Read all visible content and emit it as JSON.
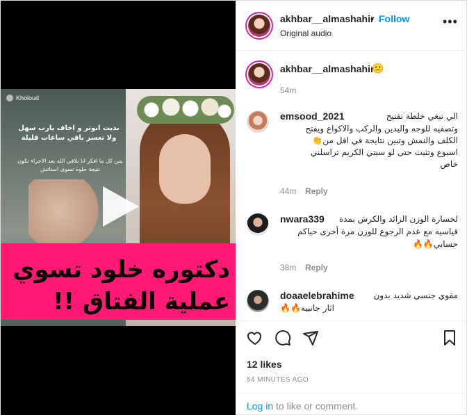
{
  "post": {
    "username": "akhbar__almashahir",
    "follow_label": "Follow",
    "separator": "•",
    "audio": "Original audio",
    "caption_emoji": "😕",
    "caption_time": "54m"
  },
  "media": {
    "story_name": "Kholoud",
    "story_text_main": "بديت انوتر و اخاف يارب سهل ولا تعسر باقي ساعات قليلة",
    "story_text_small": "بس كل ما افكر انا بلاقي الله بعد الاجراء تكون نتيجة حلوة تسوى استاتش",
    "banner_line1": "دكتوره خلود تسوي",
    "banner_line2": "عملية الفتاق !!"
  },
  "comments": [
    {
      "username": "emsood_2021",
      "text_line1": "الي تبغي خلطة تفتيح",
      "text_lines": [
        "وتصفيه للوجه واليدين والركب والاكواع ويفتح",
        "الكلف والنمش وتبين نتايجة في اقل من👏",
        "اسبوع وتثبت حتى لو سبتي الكريم تراسلني",
        "خاص"
      ],
      "time": "44m",
      "reply": "Reply"
    },
    {
      "username": "nwara339",
      "text_line1": "لخسارة الوزن الزائد والكرش بمدة",
      "text_lines": [
        "قياسيه مع عدم الرجوع للوزن مرة أخرى حياكم",
        "حسابي🔥🔥"
      ],
      "time": "38m",
      "reply": "Reply"
    },
    {
      "username": "doaaelebrahime",
      "text_line1": "مقوي جنسي شديد بدون",
      "text_lines": [
        "اثار جانبيه🔥🔥"
      ]
    }
  ],
  "engagement": {
    "likes": "12 likes",
    "timestamp": "54 MINUTES AGO"
  },
  "login": {
    "link": "Log in",
    "rest": " to like or comment."
  },
  "colors": {
    "accent": "#0095f6",
    "banner": "#ff1a75",
    "muted": "#8e8e8e"
  }
}
